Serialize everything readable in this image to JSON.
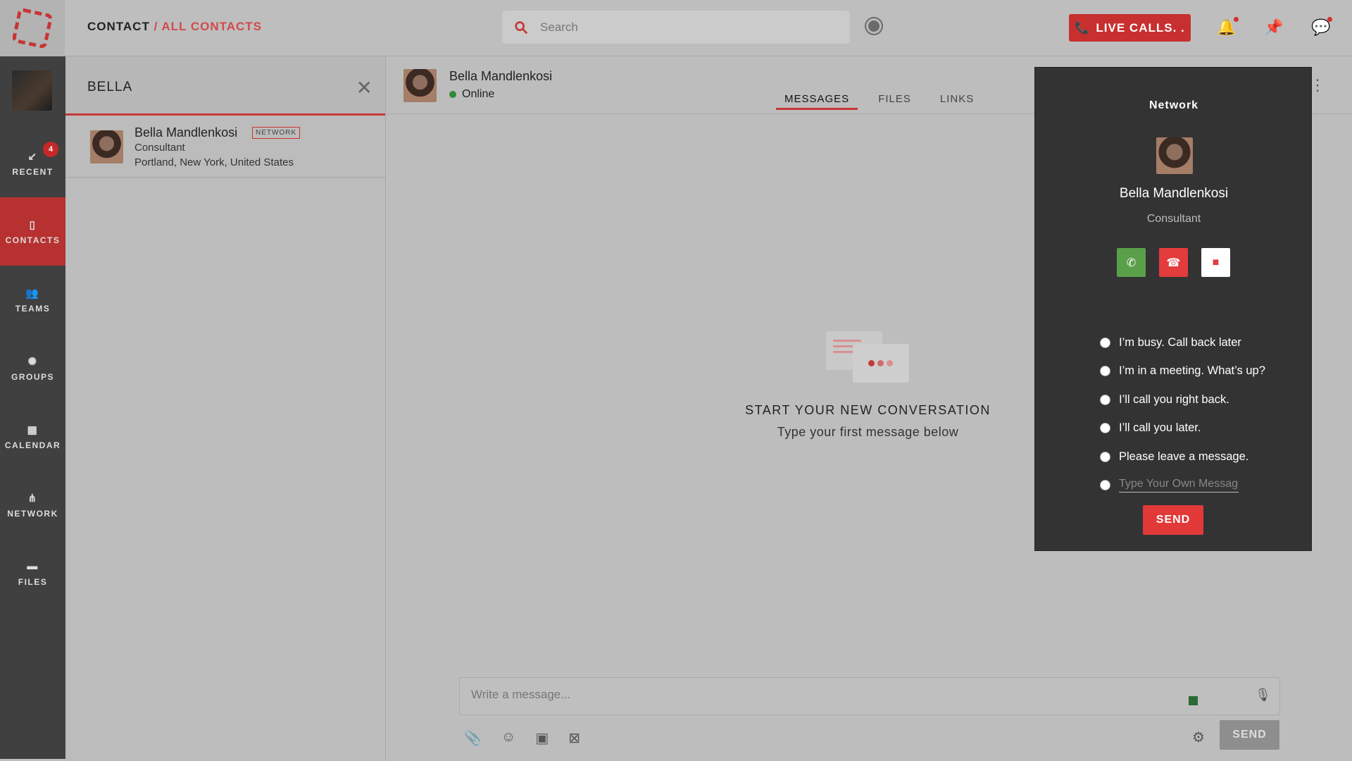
{
  "header": {
    "breadcrumb_root": "CONTACT",
    "breadcrumb_sep": " / ",
    "breadcrumb_current": "ALL CONTACTS",
    "search_placeholder": "Search",
    "live_calls_label": "LIVE CALLS. ."
  },
  "rail": {
    "recent_label": "RECENT",
    "recent_badge": "4",
    "contacts_label": "CONTACTS",
    "teams_label": "TEAMS",
    "groups_label": "GROUPS",
    "calendar_label": "CALENDAR",
    "network_label": "NETWORK",
    "files_label": "FILES"
  },
  "list": {
    "query": "BELLA",
    "contacts": [
      {
        "name": "Bella Mandlenkosi",
        "tag": "NETWORK",
        "role": "Consultant",
        "location": "Portland, New York, United States"
      }
    ]
  },
  "chat": {
    "name": "Bella Mandlenkosi",
    "status": "Online",
    "tabs": [
      "MESSAGES",
      "FILES",
      "LINKS"
    ],
    "empty_title": "START YOUR NEW CONVERSATION",
    "empty_subtitle": "Type your first message below",
    "composer_placeholder": "Write a message...",
    "send_label": "SEND"
  },
  "dialog": {
    "title": "Network",
    "name": "Bella Mandlenkosi",
    "role": "Consultant",
    "options": [
      "I’m busy. Call back later",
      "I’m in a meeting. What’s up?",
      "I’ll call you right back.",
      "I’ll call you later.",
      "Please leave a message."
    ],
    "own_placeholder": "Type Your Own Message",
    "send_label": "SEND"
  },
  "colors": {
    "accent": "#c83737",
    "call_green": "#5aa04a",
    "decline_red": "#e43c3c"
  }
}
